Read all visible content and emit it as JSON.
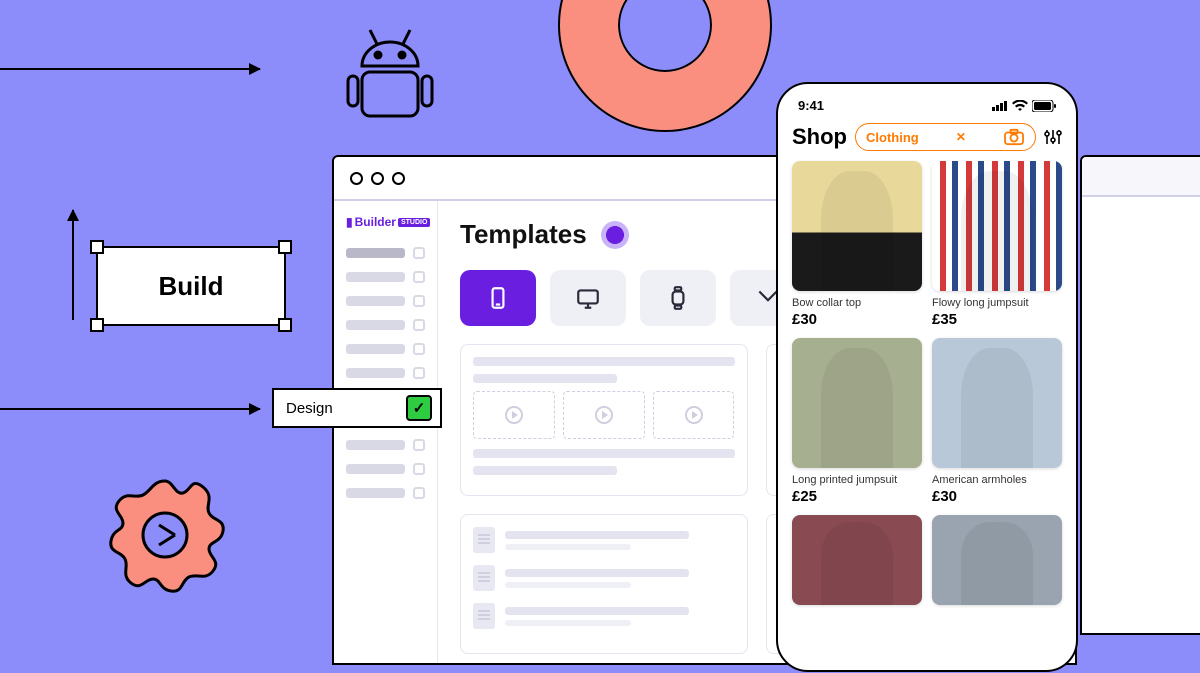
{
  "decor": {
    "build_label": "Build",
    "design_label": "Design"
  },
  "browser": {
    "logo_text": "Builder",
    "logo_badge": "STUDIO",
    "heading": "Templates"
  },
  "phone": {
    "time": "9:41",
    "title": "Shop",
    "chip_label": "Clothing",
    "products": [
      {
        "name": "Bow collar top",
        "price": "£30"
      },
      {
        "name": "Flowy long jumpsuit",
        "price": "£35"
      },
      {
        "name": "Long printed jumpsuit",
        "price": "£25"
      },
      {
        "name": "American armholes",
        "price": "£30"
      }
    ]
  },
  "colors": {
    "bg": "#8c8cfa",
    "coral": "#fa8f7f",
    "purple": "#6a1fe0",
    "orange": "#ff7a00",
    "green": "#2ecc40"
  }
}
